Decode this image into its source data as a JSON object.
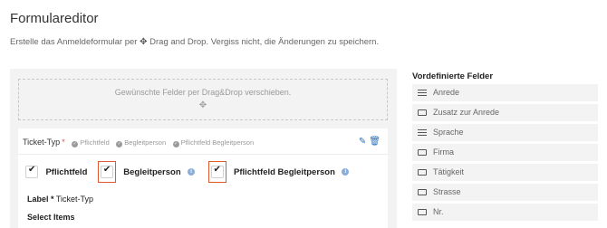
{
  "header": {
    "title": "Formulareditor",
    "subtitle_pre": "Erstelle das Anmeldeformular per",
    "subtitle_post": "Drag and Drop. Vergiss nicht, die Änderungen zu speichern."
  },
  "dropzone": {
    "hint": "Gewünschte Felder per Drag&Drop verschieben."
  },
  "field": {
    "name": "Ticket-Typ",
    "required_mark": "*",
    "tags": [
      "Pflichtfeld",
      "Begleitperson",
      "Pflichtfeld Begleitperson"
    ],
    "checkboxes": [
      {
        "label": "Pflichtfeld",
        "checked": true
      },
      {
        "label": "Begleitperson",
        "checked": true
      },
      {
        "label": "Pflichtfeld Begleitperson",
        "checked": true
      }
    ],
    "label_title": "Label *",
    "label_value": "Ticket-Typ",
    "select_items": "Select Items"
  },
  "sidebar": {
    "title": "Vordefinierte Felder",
    "items": [
      {
        "label": "Anrede",
        "icon": "list-icon"
      },
      {
        "label": "Zusatz zur Anrede",
        "icon": "input-icon"
      },
      {
        "label": "Sprache",
        "icon": "list-icon"
      },
      {
        "label": "Firma",
        "icon": "input-icon"
      },
      {
        "label": "Tätigkeit",
        "icon": "input-icon"
      },
      {
        "label": "Strasse",
        "icon": "input-icon"
      },
      {
        "label": "Nr.",
        "icon": "input-icon"
      }
    ]
  },
  "colors": {
    "highlight": "#e0582f",
    "action": "#2a6fb5",
    "required": "#d9534f"
  }
}
